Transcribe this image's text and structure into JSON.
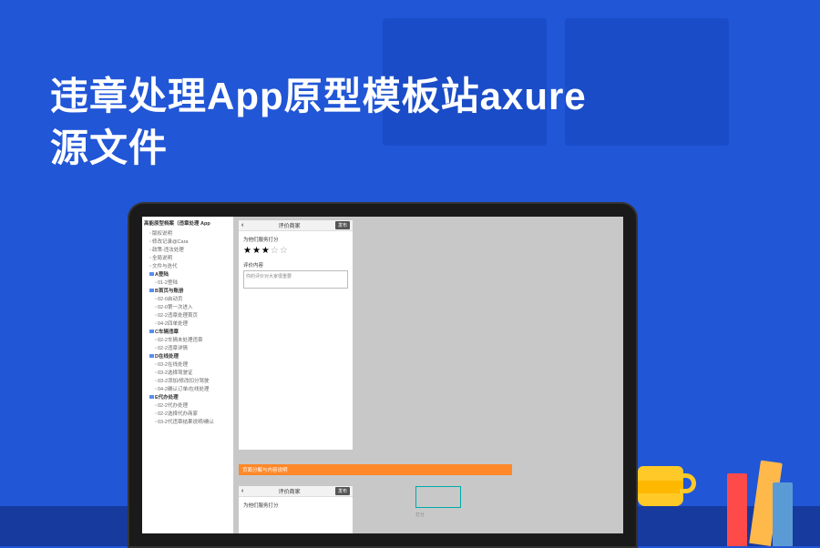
{
  "title_line1": "违章处理App原型模板站axure",
  "title_line2": "源文件",
  "sidebar": {
    "header": "高能原型档案（违章处理 App",
    "items": [
      {
        "level": 0,
        "folder": false,
        "label": "版权说明"
      },
      {
        "level": 0,
        "folder": false,
        "label": "修改记录@Cara"
      },
      {
        "level": 0,
        "folder": false,
        "label": "政策-违法处理"
      },
      {
        "level": 0,
        "folder": false,
        "label": "全局说明"
      },
      {
        "level": 0,
        "folder": false,
        "label": "文件与迭代"
      },
      {
        "level": 0,
        "folder": true,
        "label": "A登陆"
      },
      {
        "level": 1,
        "folder": false,
        "label": "01-2登陆"
      },
      {
        "level": 0,
        "folder": true,
        "label": "B首页与账册"
      },
      {
        "level": 1,
        "folder": false,
        "label": "02-0启动页"
      },
      {
        "level": 1,
        "folder": false,
        "label": "02-0第一次进入"
      },
      {
        "level": 1,
        "folder": false,
        "label": "02-2违章处理首页"
      },
      {
        "level": 1,
        "folder": false,
        "label": "04-2四单处理"
      },
      {
        "level": 0,
        "folder": true,
        "label": "C车辆违章"
      },
      {
        "level": 1,
        "folder": false,
        "label": "02-2车辆未处理违章"
      },
      {
        "level": 1,
        "folder": false,
        "label": "02-2违章详情"
      },
      {
        "level": 0,
        "folder": true,
        "label": "D在线处理"
      },
      {
        "level": 1,
        "folder": false,
        "label": "03-2在线处理"
      },
      {
        "level": 1,
        "folder": false,
        "label": "03-2选择驾驶证"
      },
      {
        "level": 1,
        "folder": false,
        "label": "03-2添加/修改扣分驾驶"
      },
      {
        "level": 1,
        "folder": false,
        "label": "04-2确认订单/在线处理"
      },
      {
        "level": 0,
        "folder": true,
        "label": "E代办处理"
      },
      {
        "level": 1,
        "folder": false,
        "label": "02-2代办处理"
      },
      {
        "level": 1,
        "folder": false,
        "label": "02-2选择代办商家"
      },
      {
        "level": 1,
        "folder": false,
        "label": "03-2代违章结果说明/确认"
      }
    ]
  },
  "phone1": {
    "header_title": "评价商家",
    "header_btn": "发布",
    "rating_label": "为他们服务打分",
    "filled_stars": 3,
    "empty_stars": 2,
    "content_label": "评价内容",
    "placeholder": "你的评价对大家很重要"
  },
  "annotation": "页面分解与内容说明",
  "phone2": {
    "header_title": "评价商家",
    "rating_label": "为他们服务打分"
  },
  "blue_note": "打分"
}
